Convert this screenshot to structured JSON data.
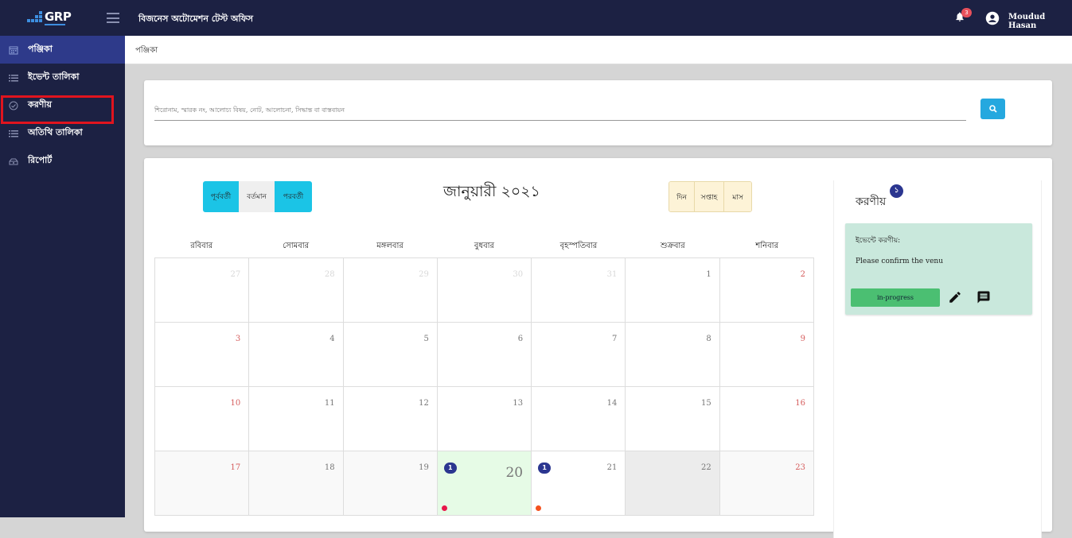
{
  "header": {
    "logo_text": "GRP",
    "org_title": "বিজনেস অটোমেশন টেস্ট অফিস",
    "notification_count": "3",
    "user_name": "Moudud Hasan"
  },
  "sidebar": {
    "items": [
      {
        "label": "পঞ্জিকা",
        "icon": "calendar-icon",
        "active": true
      },
      {
        "label": "ইভেন্ট তালিকা",
        "icon": "list-icon",
        "active": false
      },
      {
        "label": "করণীয়",
        "icon": "check-circle-icon",
        "active": false
      },
      {
        "label": "অতিথি তালিকা",
        "icon": "list-icon",
        "active": false
      },
      {
        "label": "রিপোর্ট",
        "icon": "report-icon",
        "active": false
      }
    ]
  },
  "breadcrumb": "পঞ্জিকা",
  "search": {
    "placeholder": "শিরোনাম, স্মারক নং, আলোচ্য বিষয়, নোট, আলোচনা, সিদ্ধান্ত বা বাস্তবায়ন"
  },
  "calendar": {
    "nav": {
      "prev": "পূর্ববর্তী",
      "today": "বর্তমান",
      "next": "পরবর্তী"
    },
    "views": {
      "day": "দিন",
      "week": "সপ্তাহ",
      "month": "মাস"
    },
    "title": "জানুয়ারী ২০২১",
    "weekdays": [
      "রবিবার",
      "সোমবার",
      "মঙ্গলবার",
      "বুধবার",
      "বৃহস্পতিবার",
      "শুক্রবার",
      "শনিবার"
    ],
    "weeks": [
      [
        {
          "d": "27",
          "other": true
        },
        {
          "d": "28",
          "other": true
        },
        {
          "d": "29",
          "other": true
        },
        {
          "d": "30",
          "other": true
        },
        {
          "d": "31",
          "other": true
        },
        {
          "d": "1"
        },
        {
          "d": "2",
          "weekend": true
        }
      ],
      [
        {
          "d": "3",
          "weekend": true
        },
        {
          "d": "4"
        },
        {
          "d": "5"
        },
        {
          "d": "6"
        },
        {
          "d": "7"
        },
        {
          "d": "8"
        },
        {
          "d": "9",
          "weekend": true
        }
      ],
      [
        {
          "d": "10",
          "weekend": true
        },
        {
          "d": "11"
        },
        {
          "d": "12"
        },
        {
          "d": "13"
        },
        {
          "d": "14"
        },
        {
          "d": "15"
        },
        {
          "d": "16",
          "weekend": true
        }
      ],
      [
        {
          "d": "17",
          "weekend": true,
          "fade": true
        },
        {
          "d": "18",
          "fade": true
        },
        {
          "d": "19",
          "fade": true
        },
        {
          "d": "20",
          "today": true,
          "events": "1",
          "dot": "#e8174a"
        },
        {
          "d": "21",
          "events": "1",
          "dot": "#f4511e"
        },
        {
          "d": "22",
          "grey": true
        },
        {
          "d": "23",
          "weekend": true,
          "fade": true
        }
      ]
    ]
  },
  "todo_panel": {
    "title": "করণীয়",
    "count": "১",
    "card": {
      "heading": "ইভেন্টে করণীয়:",
      "text": "Please confirm the venu",
      "status": "in-progress"
    }
  }
}
